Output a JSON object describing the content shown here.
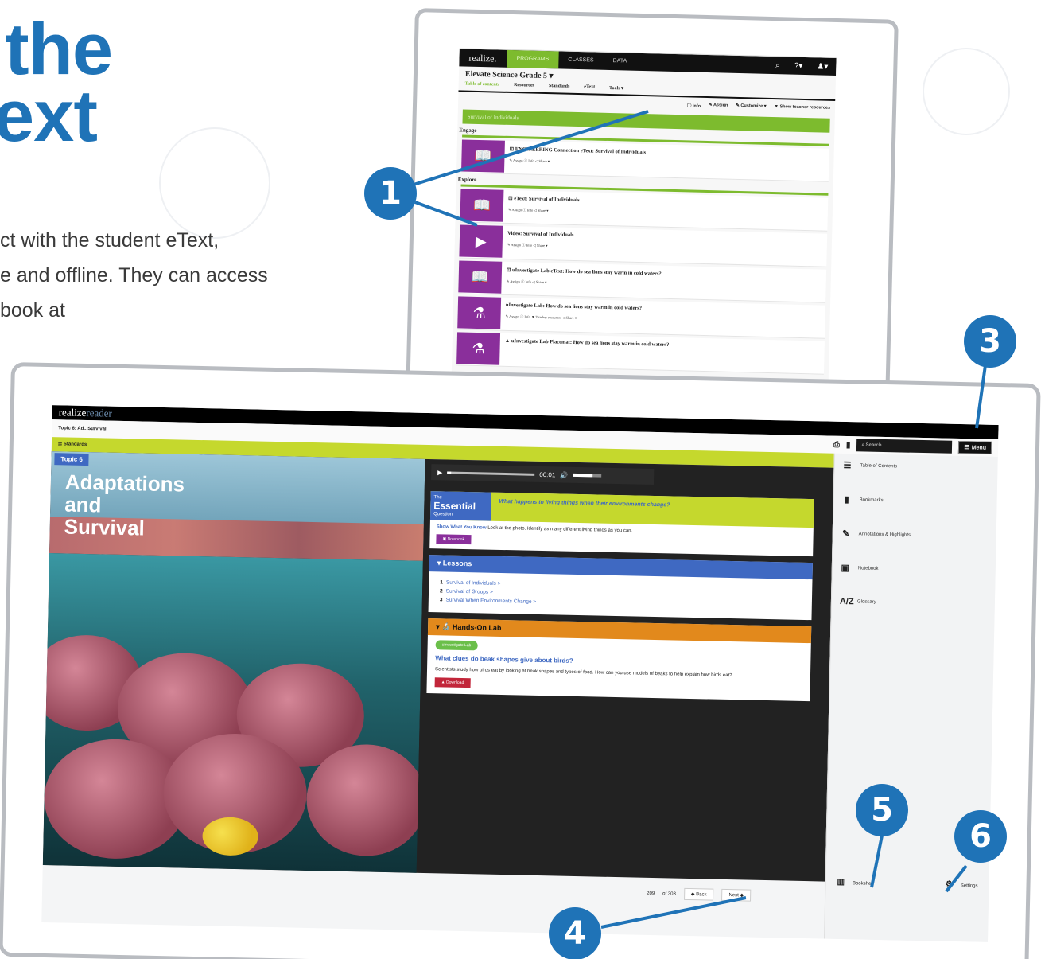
{
  "heading": {
    "line1": "the",
    "line2": "ext"
  },
  "intro": {
    "line1": "ct with the student eText,",
    "line2": "e and offline. They can access",
    "line3": "book at"
  },
  "tablet1": {
    "logo": "realize.",
    "nav": [
      "PROGRAMS",
      "CLASSES",
      "DATA"
    ],
    "nav_right": [
      "⌕",
      "?▾",
      "♟▾"
    ],
    "title": "Elevate Science Grade 5 ▾",
    "subtabs": [
      "Table of contents",
      "Resources",
      "Standards",
      "eText",
      "Tools ▾"
    ],
    "tools": [
      "ⓘ Info",
      "✎ Assign",
      "✎ Customize ▾",
      "▼ Show teacher resources"
    ],
    "section": "Survival of Individuals",
    "label_engage": "Engage",
    "label_explore": "Explore",
    "items": [
      {
        "icon": "📖",
        "name": "⊡ ENGINEERING Connection eText: Survival of Individuals",
        "acts": "✎ Assign  ⓘ Info  ◁ Share ▾"
      },
      {
        "icon": "📖",
        "name": "⊡ eText: Survival of Individuals",
        "acts": "✎ Assign  ⓘ Info  ◁ Share ▾"
      },
      {
        "icon": "▶",
        "name": "Video: Survival of Individuals",
        "acts": "✎ Assign  ⓘ Info  ◁ Share ▾"
      },
      {
        "icon": "📖",
        "name": "⊡ uInvestigate Lab eText: How do sea lions stay warm in cold waters?",
        "acts": "✎ Assign  ⓘ Info  ◁ Share ▾"
      },
      {
        "icon": "⚗",
        "name": "uInvestigate Lab: How do sea lions stay warm in cold waters?",
        "acts": "✎ Assign  ⓘ Info  ▼ Teacher resources  ◁ Share ▾"
      },
      {
        "icon": "⚗",
        "name": "▲ uInvestigate Lab Placemat: How do sea lions stay warm in cold waters?",
        "acts": ""
      }
    ]
  },
  "tablet2": {
    "logo_a": "realize",
    "logo_b": "reader",
    "breadcrumb": "Topic 6: Ad...Survival",
    "search_placeholder": "Search",
    "menu_label": "Menu",
    "standards": "Standards",
    "topic_badge": "Topic 6",
    "topic_title": [
      "Adaptations",
      "and",
      "Survival"
    ],
    "audio_time": "00:01",
    "audio_progress": 0.04,
    "audio_volume": 0.7,
    "eq_badge_small": "The",
    "eq_badge_big": "Essential",
    "eq_badge_sub": "Question",
    "eq_question": "What happens to living things when their environments change?",
    "eq_swyk": "Show What You Know",
    "eq_text": "Look at the photo. Identify as many different living things as you can.",
    "notebook_btn": "Notebook",
    "lessons_title": "Lessons",
    "lessons": [
      {
        "num": "1",
        "title": "Survival of Individuals >"
      },
      {
        "num": "2",
        "title": "Survival of Groups >"
      },
      {
        "num": "3",
        "title": "Survival When Environments Change >"
      }
    ],
    "lab_title": "Hands-On Lab",
    "lab_chip": "uInvestigate Lab",
    "lab_question": "What clues do beak shapes give about birds?",
    "lab_text": "Scientists study how birds eat by looking at beak shapes and types of food. How can you use models of beaks to help explain how birds eat?",
    "download_btn": "Download",
    "sidebar": [
      {
        "icon": "☰",
        "label": "Table of Contents"
      },
      {
        "icon": "▮",
        "label": "Bookmarks"
      },
      {
        "icon": "✎",
        "label": "Annotations & Highlights"
      },
      {
        "icon": "▣",
        "label": "Notebook"
      },
      {
        "icon": "A/Z",
        "label": "Glossary"
      }
    ],
    "bookshelf": "Bookshelf",
    "settings": "Settings",
    "page_current": "209",
    "page_total": "of 303",
    "back_btn": "◆ Back",
    "next_btn": "Next ◆"
  },
  "callouts": [
    "1",
    "3",
    "4",
    "5",
    "6"
  ],
  "colors": {
    "accent_blue": "#1f73b7",
    "green": "#7dbb2e",
    "lime": "#c5d82d",
    "purple": "#8a2f9b",
    "orange": "#e2891c"
  }
}
